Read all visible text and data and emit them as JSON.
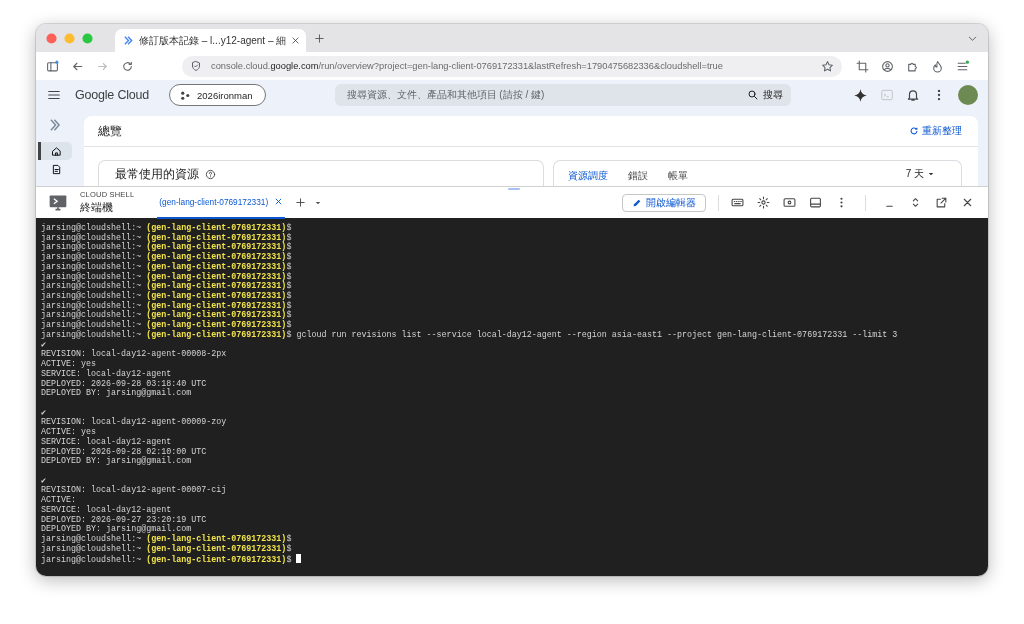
{
  "browser": {
    "tabs": [
      {
        "title": "修訂版本記錄 – l...y12-agent – 細",
        "selected": true
      }
    ],
    "url": "console.cloud.**google.com**/run/overview?project=gen-lang-client-0769172331&lastRefresh=1790475682336&cloudshell=true"
  },
  "header": {
    "product": "Google Cloud",
    "project": "2026ironman",
    "search": {
      "placeholder": "搜尋資源、文件、產品和其他項目 (請按 / 鍵)"
    },
    "search_button": "搜尋"
  },
  "rail": {
    "items": [
      {
        "kind": "home",
        "selected": true
      },
      {
        "kind": "document",
        "selected": false
      }
    ]
  },
  "overview": {
    "title": "總覽",
    "refresh": "重新整理",
    "card_title": "最常使用的資源",
    "tabs": [
      {
        "label": "資源調度",
        "selected": true
      },
      {
        "label": "錯誤",
        "selected": false
      },
      {
        "label": "帳單",
        "selected": false
      }
    ],
    "range": "7 天"
  },
  "cloud_shell": {
    "label": "CLOUD SHELL",
    "title": "終端機",
    "sessions": [
      {
        "label": "(gen-lang-client-0769172331)",
        "selected": true
      }
    ],
    "editor_button": "開啟編輯器"
  },
  "terminal": {
    "lines": [
      {
        "kind": "prompt",
        "user": "jarsing@cloudshell:~",
        "project": "(gen-lang-client-0769172331)",
        "symbol": "$",
        "cursor": false
      },
      {
        "kind": "prompt",
        "user": "jarsing@cloudshell:~",
        "project": "(gen-lang-client-0769172331)",
        "symbol": "$",
        "cursor": false
      },
      {
        "kind": "prompt",
        "user": "jarsing@cloudshell:~",
        "project": "(gen-lang-client-0769172331)",
        "symbol": "$",
        "cursor": false
      },
      {
        "kind": "prompt",
        "user": "jarsing@cloudshell:~",
        "project": "(gen-lang-client-0769172331)",
        "symbol": "$",
        "cursor": false
      },
      {
        "kind": "prompt",
        "user": "jarsing@cloudshell:~",
        "project": "(gen-lang-client-0769172331)",
        "symbol": "$",
        "cursor": false
      },
      {
        "kind": "prompt",
        "user": "jarsing@cloudshell:~",
        "project": "(gen-lang-client-0769172331)",
        "symbol": "$",
        "cursor": false
      },
      {
        "kind": "prompt",
        "user": "jarsing@cloudshell:~",
        "project": "(gen-lang-client-0769172331)",
        "symbol": "$",
        "cursor": false
      },
      {
        "kind": "prompt",
        "user": "jarsing@cloudshell:~",
        "project": "(gen-lang-client-0769172331)",
        "symbol": "$",
        "cursor": false
      },
      {
        "kind": "prompt",
        "user": "jarsing@cloudshell:~",
        "project": "(gen-lang-client-0769172331)",
        "symbol": "$",
        "cursor": false
      },
      {
        "kind": "prompt",
        "user": "jarsing@cloudshell:~",
        "project": "(gen-lang-client-0769172331)",
        "symbol": "$",
        "cursor": false
      },
      {
        "kind": "prompt",
        "user": "jarsing@cloudshell:~",
        "project": "(gen-lang-client-0769172331)",
        "symbol": "$",
        "cursor": false
      },
      {
        "kind": "prompt",
        "user": "jarsing@cloudshell:~",
        "project": "(gen-lang-client-0769172331)",
        "symbol": "$",
        "command": "gcloud run revisions list --service local-day12-agent --region asia-east1 --project gen-lang-client-0769172331 --limit 3",
        "cursor": false
      },
      {
        "kind": "output",
        "text": "✔"
      },
      {
        "kind": "output",
        "text": "REVISION: local-day12-agent-00008-2px"
      },
      {
        "kind": "output",
        "text": "ACTIVE: yes"
      },
      {
        "kind": "output",
        "text": "SERVICE: local-day12-agent"
      },
      {
        "kind": "output",
        "text": "DEPLOYED: 2026-09-28 03:18:40 UTC"
      },
      {
        "kind": "output",
        "text": "DEPLOYED BY: jarsing@gmail.com"
      },
      {
        "kind": "blank"
      },
      {
        "kind": "output",
        "text": "✔"
      },
      {
        "kind": "output",
        "text": "REVISION: local-day12-agent-00009-zoy"
      },
      {
        "kind": "output",
        "text": "ACTIVE: yes"
      },
      {
        "kind": "output",
        "text": "SERVICE: local-day12-agent"
      },
      {
        "kind": "output",
        "text": "DEPLOYED: 2026-09-28 02:10:00 UTC"
      },
      {
        "kind": "output",
        "text": "DEPLOYED BY: jarsing@gmail.com"
      },
      {
        "kind": "blank"
      },
      {
        "kind": "output",
        "text": "✔"
      },
      {
        "kind": "output",
        "text": "REVISION: local-day12-agent-00007-cij"
      },
      {
        "kind": "output",
        "text": "ACTIVE:"
      },
      {
        "kind": "output",
        "text": "SERVICE: local-day12-agent"
      },
      {
        "kind": "output",
        "text": "DEPLOYED: 2026-09-27 23:20:19 UTC"
      },
      {
        "kind": "output",
        "text": "DEPLOYED BY: jarsing@gmail.com"
      },
      {
        "kind": "prompt",
        "user": "jarsing@cloudshell:~",
        "project": "(gen-lang-client-0769172331)",
        "symbol": "$",
        "cursor": false
      },
      {
        "kind": "prompt",
        "user": "jarsing@cloudshell:~",
        "project": "(gen-lang-client-0769172331)",
        "symbol": "$",
        "cursor": false
      },
      {
        "kind": "prompt",
        "user": "jarsing@cloudshell:~",
        "project": "(gen-lang-client-0769172331)",
        "symbol": "$",
        "cursor": true
      }
    ]
  }
}
